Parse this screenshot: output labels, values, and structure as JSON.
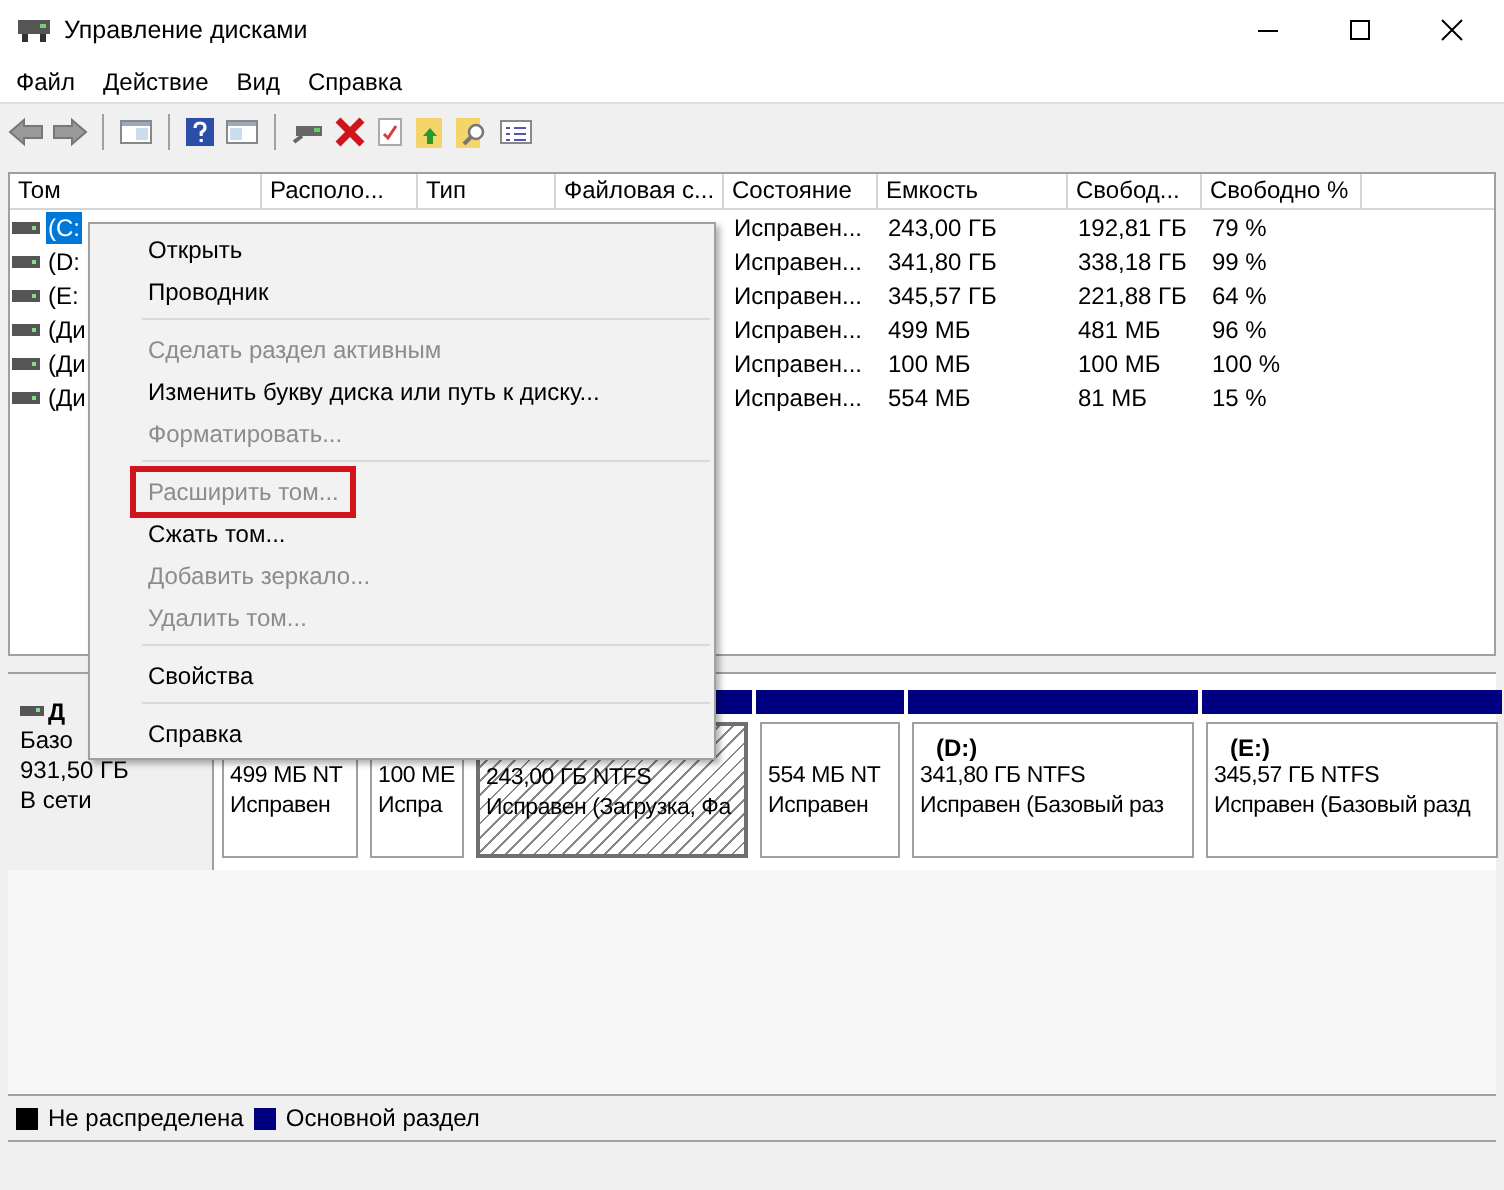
{
  "window": {
    "title": "Управление дисками"
  },
  "menu_bar": [
    {
      "label": "Файл"
    },
    {
      "label": "Действие"
    },
    {
      "label": "Вид"
    },
    {
      "label": "Справка"
    }
  ],
  "volume_list": {
    "columns": [
      "Том",
      "Располо...",
      "Тип",
      "Файловая с...",
      "Состояние",
      "Емкость",
      "Свобод...",
      "Свободно %"
    ],
    "rows": [
      {
        "volume": "(C:",
        "selected": true,
        "status": "Исправен...",
        "capacity": "243,00 ГБ",
        "free": "192,81 ГБ",
        "free_percent": "79 %"
      },
      {
        "volume": "(D:",
        "selected": false,
        "status": "Исправен...",
        "capacity": "341,80 ГБ",
        "free": "338,18 ГБ",
        "free_percent": "99 %"
      },
      {
        "volume": "(E:",
        "selected": false,
        "status": "Исправен...",
        "capacity": "345,57 ГБ",
        "free": "221,88 ГБ",
        "free_percent": "64 %"
      },
      {
        "volume": "(Ди",
        "selected": false,
        "status": "Исправен...",
        "capacity": "499 МБ",
        "free": "481 МБ",
        "free_percent": "96 %"
      },
      {
        "volume": "(Ди",
        "selected": false,
        "status": "Исправен...",
        "capacity": "100 МБ",
        "free": "100 МБ",
        "free_percent": "100 %"
      },
      {
        "volume": "(Ди",
        "selected": false,
        "status": "Исправен...",
        "capacity": "554 МБ",
        "free": "81 МБ",
        "free_percent": "15 %"
      }
    ]
  },
  "context_menu": {
    "items": [
      {
        "kind": "item",
        "label": "Открыть",
        "disabled": false,
        "highlighted": false
      },
      {
        "kind": "item",
        "label": "Проводник",
        "disabled": false,
        "highlighted": false
      },
      {
        "kind": "separator"
      },
      {
        "kind": "item",
        "label": "Сделать раздел активным",
        "disabled": true,
        "highlighted": false
      },
      {
        "kind": "item",
        "label": "Изменить букву диска или путь к диску...",
        "disabled": false,
        "highlighted": false
      },
      {
        "kind": "item",
        "label": "Форматировать...",
        "disabled": true,
        "highlighted": false
      },
      {
        "kind": "separator"
      },
      {
        "kind": "item",
        "label": "Расширить том...",
        "disabled": true,
        "highlighted": true
      },
      {
        "kind": "item",
        "label": "Сжать том...",
        "disabled": false,
        "highlighted": false
      },
      {
        "kind": "item",
        "label": "Добавить зеркало...",
        "disabled": true,
        "highlighted": false
      },
      {
        "kind": "item",
        "label": "Удалить том...",
        "disabled": true,
        "highlighted": false
      },
      {
        "kind": "separator"
      },
      {
        "kind": "item",
        "label": "Свойства",
        "disabled": false,
        "highlighted": false
      },
      {
        "kind": "separator"
      },
      {
        "kind": "item",
        "label": "Справка",
        "disabled": false,
        "highlighted": false
      }
    ]
  },
  "disk": {
    "name": "Д",
    "type": "Базо",
    "size": "931,50 ГБ",
    "status": "В сети",
    "partitions": [
      {
        "selected": false,
        "lines": [
          "499 МБ NT",
          "Исправен"
        ]
      },
      {
        "selected": false,
        "lines": [
          "100 МЕ",
          "Испра"
        ]
      },
      {
        "selected": true,
        "lines": [
          "243,00 ГБ NTFS",
          "Исправен (Загрузка, Фа"
        ]
      },
      {
        "selected": false,
        "lines": [
          "554 МБ NT",
          "Исправен"
        ]
      },
      {
        "selected": false,
        "title": "(D:)",
        "lines": [
          "341,80 ГБ NTFS",
          "Исправен (Базовый раз"
        ]
      },
      {
        "selected": false,
        "title": "(E:)",
        "lines": [
          "345,57 ГБ NTFS",
          "Исправен (Базовый разд"
        ]
      }
    ]
  },
  "legend": [
    {
      "label": "Не распределена",
      "color": "#000000"
    },
    {
      "label": "Основной раздел",
      "color": "#000080"
    }
  ]
}
